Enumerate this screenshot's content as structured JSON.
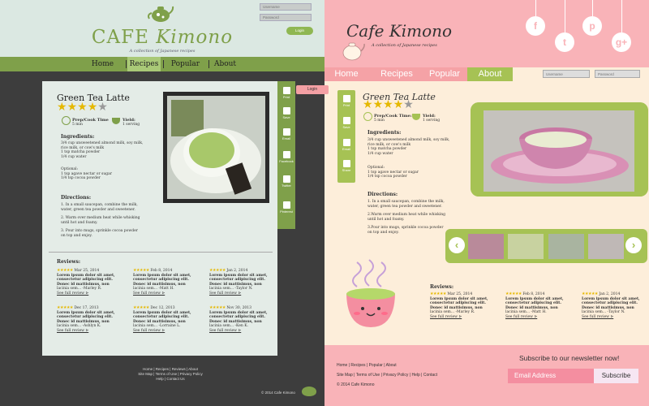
{
  "left": {
    "logo_main": "CAFE",
    "logo_italic": "Kimono",
    "tagline": "A collection of Japanese recipes",
    "username_placeholder": "Username",
    "password_placeholder": "Password",
    "login_label": "Login",
    "nav": [
      "Home",
      "Recipes",
      "Popular",
      "About"
    ],
    "share": [
      "Print",
      "Save",
      "Email",
      "Facebook",
      "Twitter",
      "Pinterest"
    ],
    "recipe": {
      "title": "Green Tea Latte",
      "rating": 4,
      "prep_label": "Prep/Cook Time",
      "prep_value": "5 min",
      "yield_label": "Yield:",
      "yield_value": "1 serving",
      "ingredients_heading": "Ingredients:",
      "ingredients": [
        "3/4 cup unsweetened almond milk, soy milk,",
        "rice milk, or cow's milk",
        "1 tsp matcha powder",
        "1/4 cup water"
      ],
      "optional_heading": "Optional:",
      "optional": [
        "1 tsp agave nectar or sugar",
        "1/4 tsp cocoa powder"
      ],
      "directions_heading": "Directions:",
      "directions": [
        "1. In a small saucepan, combine the milk,",
        "water, green tea powder and sweetener.",
        "2. Warm over medium heat while whisking",
        "until hot and foamy.",
        "3. Pour into mugs, sprinkle cocoa powder",
        "on top and enjoy."
      ]
    },
    "reviews_heading": "Reviews:",
    "reviews": [
      {
        "date": "Mar 25, 2014",
        "text1": "Lorem ipsum dolor sit amet,",
        "text2": "consectetur adipiscing elit.",
        "text3": "Donec id mattisimus, non",
        "text4": "lacinia sem... -Marley R.",
        "link": "See full review"
      },
      {
        "date": "Feb 8, 2014",
        "text1": "Lorem ipsum dolor sit amet,",
        "text2": "consectetur adipiscing elit.",
        "text3": "Donec id mattisimus, non",
        "text4": "lacinia sem... -Matt H.",
        "link": "See full review"
      },
      {
        "date": "Jan 2, 2014",
        "text1": "Lorem ipsum dolor sit amet,",
        "text2": "consectetur adipiscing elit.",
        "text3": "Donec id mattisimus, non",
        "text4": "lacinia sem... -Taylor N.",
        "link": "See full review"
      },
      {
        "date": "Dec 17, 2013",
        "text1": "Lorem ipsum dolor sit amet,",
        "text2": "consectetur adipiscing elit.",
        "text3": "Donec id mattisimus, non",
        "text4": "lacinia sem... -Ashlyn K.",
        "link": "See full review"
      },
      {
        "date": "Dec 12, 2013",
        "text1": "Lorem ipsum dolor sit amet,",
        "text2": "consectetur adipiscing elit.",
        "text3": "Donec id mattisimus, non",
        "text4": "lacinia sem... -Lorraine L.",
        "link": "See full review"
      },
      {
        "date": "Nov 30, 2013",
        "text1": "Lorem ipsum dolor sit amet,",
        "text2": "consectetur adipiscing elit.",
        "text3": "Donec id mattisimus, non",
        "text4": "lacinia sem... -Ken K.",
        "link": "See full review"
      }
    ],
    "footer_row1": [
      "Home",
      "Recipes",
      "Reviews",
      "About"
    ],
    "footer_row2": [
      "Site Map",
      "Terms of Use",
      "Privacy Policy"
    ],
    "footer_row3": [
      "Help",
      "Contact Us"
    ],
    "copyright": "© 2014 Cafe Kimono"
  },
  "right": {
    "logo": "Cafe Kimono",
    "tagline": "A collection of Japanese recipes",
    "social": [
      "f",
      "t",
      "p",
      "g+"
    ],
    "nav": [
      "Home",
      "Recipes",
      "Popular",
      "About"
    ],
    "username_placeholder": "Username",
    "password_placeholder": "Password",
    "login_label": "Login",
    "share": [
      "Print",
      "Save",
      "Email",
      "Share"
    ],
    "recipe": {
      "title": "Green Tea Latte",
      "rating": 4,
      "prep_label": "Prep/Cook Time:",
      "prep_value": "5 min",
      "yield_label": "Yield:",
      "yield_value": "1 serving",
      "ingredients_heading": "Ingredients:",
      "ingredients": [
        "3/4 cup unsweetened almond milk, soy milk,",
        "rice milk, or cow's milk",
        "1 tsp matcha powder",
        "1/4 cup water"
      ],
      "optional_heading": "Optional:",
      "optional": [
        "1 tsp agave nectar or sugar",
        "1/4 tsp cocoa powder"
      ],
      "directions_heading": "Directions:",
      "directions": [
        "1. In a small saucepan, combine the milk,",
        "water, green tea powder and sweetener.",
        "2.Warm over medium heat while whisking",
        "until hot and foamy.",
        "3.Pour into mugs, sprinkle cocoa powder",
        "on top and enjoy."
      ]
    },
    "reviews_heading": "Reviews:",
    "reviews": [
      {
        "date": "Mar 25, 2014",
        "text1": "Lorem ipsum dolor sit amet,",
        "text2": "consectetur adipiscing elit.",
        "text3": "Donec id mattisimus, non",
        "text4": "lacinia sem... -Marley R.",
        "link": "See full review"
      },
      {
        "date": "Feb 8, 2014",
        "text1": "Lorem ipsum dolor sit amet,",
        "text2": "consectetur adipiscing elit.",
        "text3": "Donec id mattisimus, non",
        "text4": "lacinia sem... -Matt H.",
        "link": "See full review"
      },
      {
        "date": "Jan 2, 2014",
        "text1": "Lorem ipsum dolor sit amet,",
        "text2": "consectetur adipiscing elit.",
        "text3": "Donec id mattisimus, non",
        "text4": "lacinia sem... -Taylor N.",
        "link": "See full review"
      }
    ],
    "footer_row1": [
      "Home",
      "Recipes",
      "Popular",
      "About"
    ],
    "footer_row2": [
      "Site Map",
      "Terms of Use",
      "Privacy Policy",
      "Help",
      "Contact"
    ],
    "copyright": "© 2014 Cafe Kimono",
    "newsletter_heading": "Subscribe to our newsletter now!",
    "email_placeholder": "Email Address",
    "subscribe_label": "Subscribe"
  },
  "colors": {
    "left_green": "#7fa04a",
    "left_bg": "#3d3d3d",
    "right_pink": "#f9b3b8",
    "right_green": "#a6c254",
    "star": "#e5b800"
  }
}
